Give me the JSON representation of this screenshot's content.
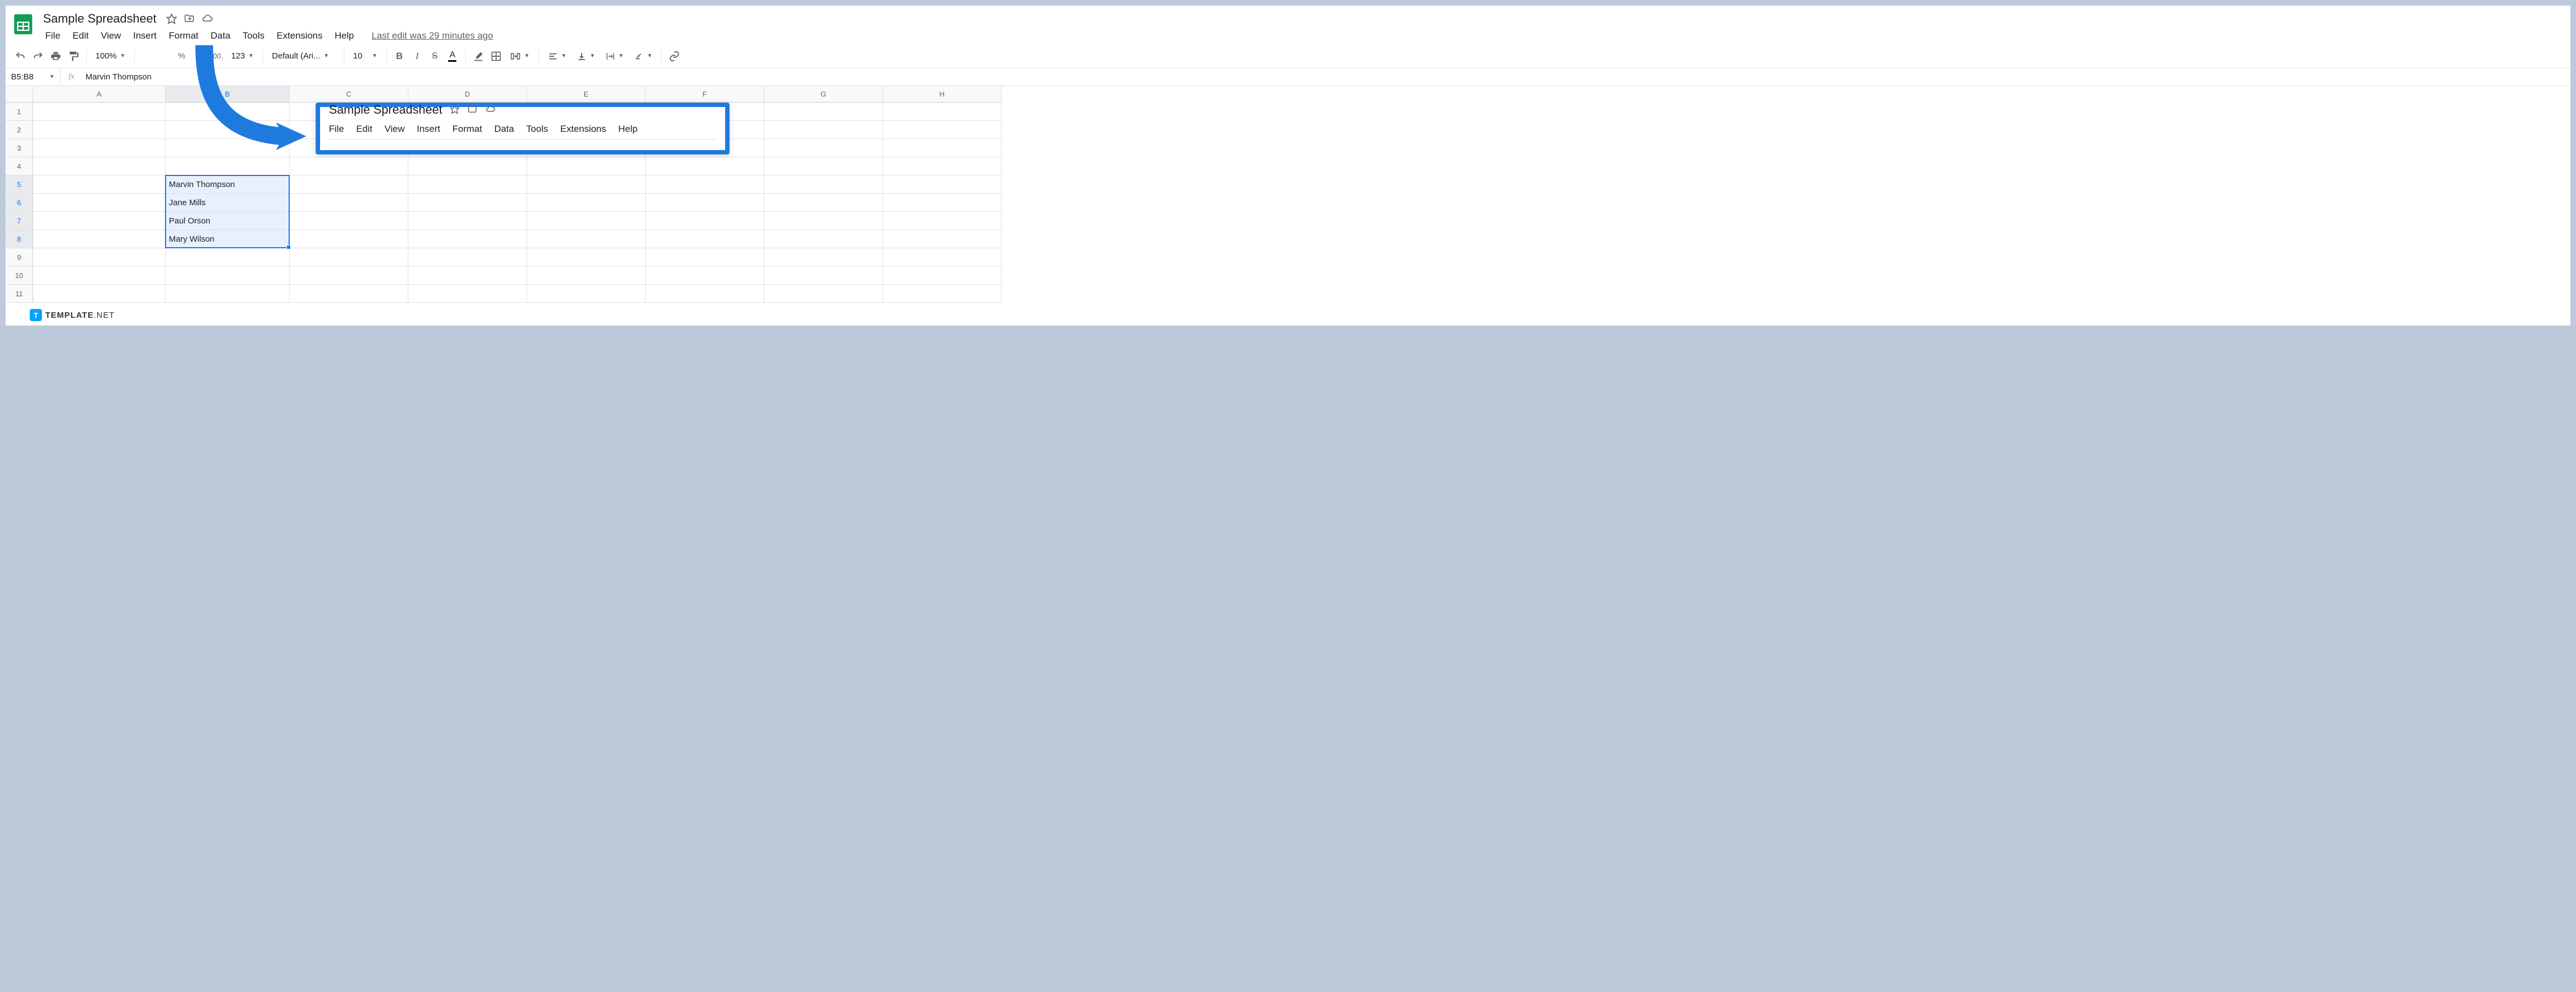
{
  "header": {
    "title": "Sample Spreadsheet",
    "last_edit": "Last edit was 29 minutes ago"
  },
  "menu": [
    "File",
    "Edit",
    "View",
    "Insert",
    "Format",
    "Data",
    "Tools",
    "Extensions",
    "Help"
  ],
  "toolbar": {
    "zoom": "100%",
    "font": "Default (Ari...",
    "font_size": "10",
    "percent": "%",
    "dec_dec": ".0",
    "inc_dec": ".00",
    "num_format": "123"
  },
  "formula_bar": {
    "name_box": "B5:B8",
    "fx": "fx",
    "value": "Marvin Thompson"
  },
  "columns": [
    "A",
    "B",
    "C",
    "D",
    "E",
    "F",
    "G",
    "H"
  ],
  "rows": [
    "1",
    "2",
    "3",
    "4",
    "5",
    "6",
    "7",
    "8",
    "9",
    "10",
    "11"
  ],
  "cells": {
    "B5": "Marvin Thompson",
    "B6": "Jane Mills",
    "B7": "Paul Orson",
    "B8": "Mary Wilson"
  },
  "callout": {
    "title": "Sample Spreadsheet",
    "menu": [
      "File",
      "Edit",
      "View",
      "Insert",
      "Format",
      "Data",
      "Tools",
      "Extensions",
      "Help"
    ]
  },
  "watermark": {
    "icon": "T",
    "brand": "TEMPLATE",
    "suffix": ".NET"
  }
}
